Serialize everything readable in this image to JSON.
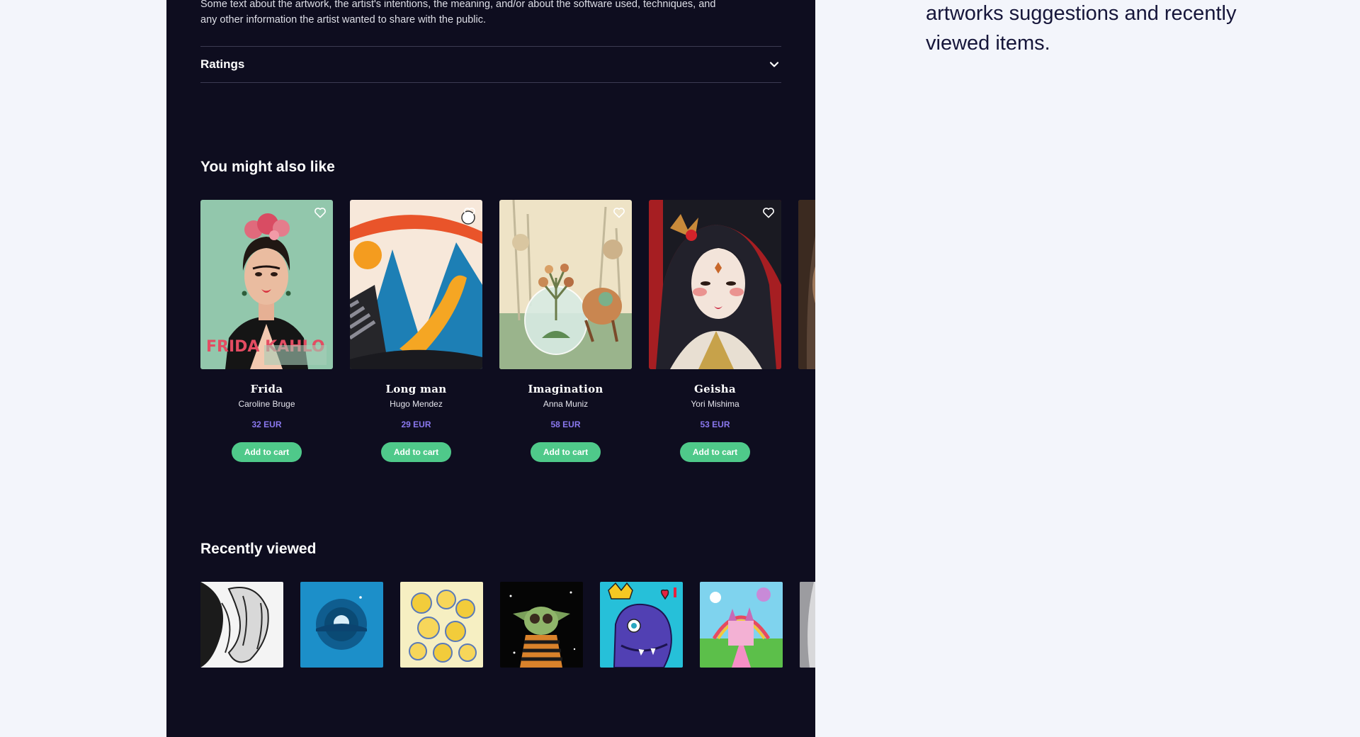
{
  "description": "Some text about the artwork, the artist's intentions, the meaning, and/or about the software used, techniques, and any other information the artist wanted to share with the public.",
  "ratings": {
    "label": "Ratings"
  },
  "suggestions": {
    "title": "You might also like",
    "cart_label": "Add to cart",
    "items": [
      {
        "title": "Frida",
        "artist": "Caroline Bruge",
        "price": "32 EUR",
        "art_text": "FRIDA KAHLO"
      },
      {
        "title": "Long man",
        "artist": "Hugo Mendez",
        "price": "29 EUR"
      },
      {
        "title": "Imagination",
        "artist": "Anna Muniz",
        "price": "58 EUR"
      },
      {
        "title": "Geisha",
        "artist": "Yori Mishima",
        "price": "53 EUR"
      }
    ]
  },
  "recent": {
    "title": "Recently viewed"
  },
  "side_note": "artworks suggestions and recently viewed items.",
  "colors": {
    "background": "#0e0d1f",
    "accent_price": "#8a78ee",
    "button": "#4fc98a",
    "page": "#f3f5fb"
  }
}
